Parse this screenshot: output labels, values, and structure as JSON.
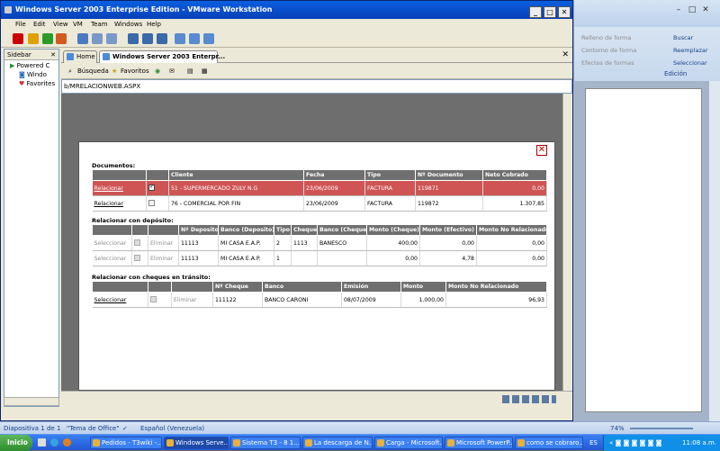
{
  "vm": {
    "title": "Windows Server 2003 Enterprise Edition - VMware Workstation",
    "menu": [
      "File",
      "Edit",
      "View",
      "VM",
      "Team",
      "Windows",
      "Help"
    ],
    "sidebar": {
      "header": "Sidebar",
      "close": "✕",
      "items": [
        "Powered C",
        "Windo",
        "Favorites"
      ]
    },
    "tabs": {
      "home": "Home",
      "active": "Windows Server 2003 Enterpr..."
    },
    "ie": {
      "search": "Búsqueda",
      "favorites": "Favoritos",
      "address": "b/MRELACIONWEB.ASPX"
    }
  },
  "modal": {
    "close": "✕",
    "documentos": {
      "title": "Documentos:",
      "headers": [
        "",
        "",
        "Cliente",
        "Fecha",
        "Tipo",
        "Nº Documento",
        "Neto Cobrado"
      ],
      "rows": [
        {
          "action": "Relacionar",
          "cliente": "51 - SUPERMERCADO ZULY N.G",
          "fecha": "23/06/2009",
          "tipo": "FACTURA",
          "num": "119871",
          "neto": "0,00",
          "selected": true
        },
        {
          "action": "Relacionar",
          "cliente": "76 - COMERCIAL POR FIN",
          "fecha": "23/06/2009",
          "tipo": "FACTURA",
          "num": "119872",
          "neto": "1.307,85",
          "selected": false
        }
      ]
    },
    "deposito": {
      "title": "Relacionar con depósito:",
      "headers": [
        "",
        "",
        "",
        "Nº Deposito",
        "Banco (Deposito)",
        "Tipo",
        "Cheque",
        "Banco (Cheque)",
        "Monto (Cheque)",
        "Monto (Efectivo)",
        "Monto No Relacionado"
      ],
      "rows": [
        {
          "sel": "Seleccionar",
          "del": "Eliminar",
          "num": "11113",
          "banco": "MI CASA E.A.P.",
          "tipo": "2",
          "cheque": "1113",
          "bancoCh": "BANESCO",
          "montoCh": "400,00",
          "montoEf": "0,00",
          "noRel": "0,00"
        },
        {
          "sel": "Seleccionar",
          "del": "Eliminar",
          "num": "11113",
          "banco": "MI CASA E.A.P.",
          "tipo": "1",
          "cheque": "",
          "bancoCh": "",
          "montoCh": "0,00",
          "montoEf": "4,78",
          "noRel": "0,00"
        }
      ]
    },
    "cheques": {
      "title": "Relacionar con cheques en tránsito:",
      "headers": [
        "",
        "",
        "",
        "Nº Cheque",
        "Banco",
        "Emisión",
        "Monto",
        "Monto No Relacionado"
      ],
      "rows": [
        {
          "sel": "Seleccionar",
          "del": "Eliminar",
          "num": "111122",
          "banco": "BANCO CARONI",
          "emision": "08/07/2009",
          "monto": "1.000,00",
          "noRel": "96,93"
        }
      ]
    }
  },
  "word": {
    "ribbon": {
      "relleno": "Relleno de forma",
      "contorno": "Contorno de forma",
      "efectos": "Efectos de formas",
      "buscar": "Buscar",
      "reemplazar": "Reemplazar",
      "seleccionar": "Seleccionar",
      "edicion": "Edición"
    },
    "status": {
      "page": "Diapositiva 1 de 1",
      "theme": "\"Tema de Office\"",
      "lang": "Español (Venezuela)",
      "zoom": "74%"
    }
  },
  "taskbar": {
    "start": "Inicio",
    "items": [
      "Pedidos - T3wiki -...",
      "Windows Serve...",
      "Sistema T3 - 8 1...",
      "La descarga de N...",
      "Carga - Microsoft...",
      "Microsoft PowerP...",
      "como se cobraro..."
    ],
    "lang": "ES",
    "clock": "11:08 a.m."
  }
}
